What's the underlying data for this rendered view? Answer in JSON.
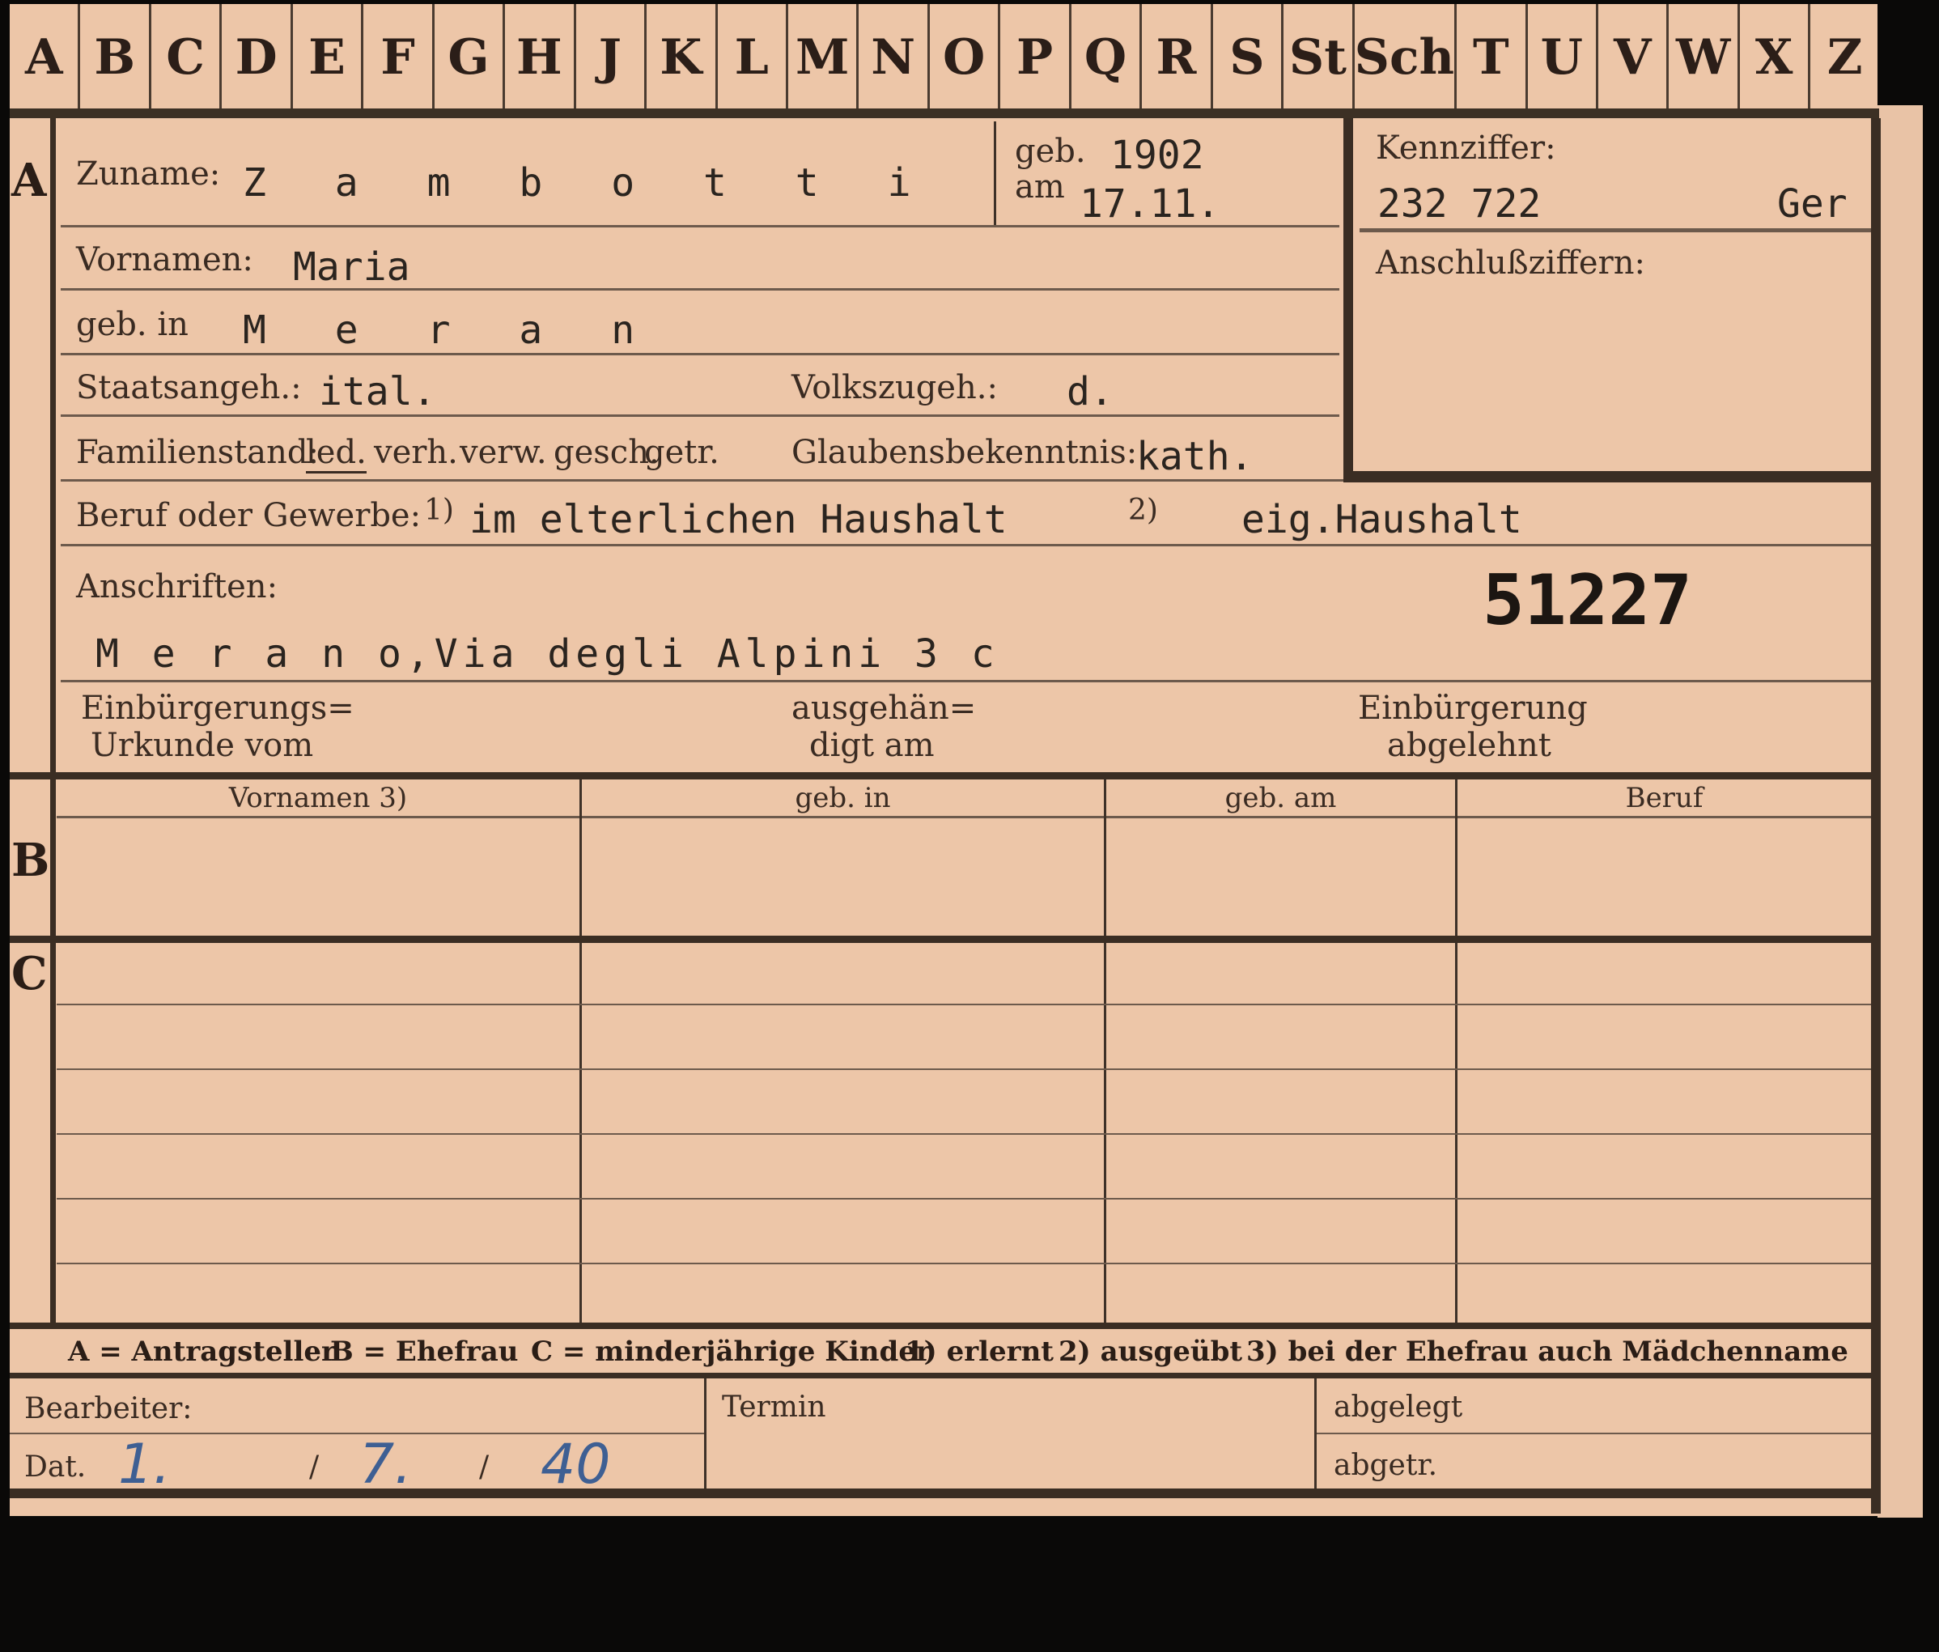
{
  "tabs": [
    "A",
    "B",
    "C",
    "D",
    "E",
    "F",
    "G",
    "H",
    "J",
    "K",
    "L",
    "M",
    "N",
    "O",
    "P",
    "Q",
    "R",
    "S",
    "St",
    "Sch",
    "T",
    "U",
    "V",
    "W",
    "X",
    "Z"
  ],
  "section_a": {
    "letter": "A",
    "zuname_label": "Zuname:",
    "zuname_value": "Z a m b o t t i",
    "geb_label": "geb.",
    "am_label": "am",
    "geb_year": "1902",
    "geb_date": "17.11.",
    "kennziffer_label": "Kennziffer:",
    "kennziffer_value": "232 722",
    "kennziffer_suffix": "Ger",
    "anschluss_label": "Anschlußziffern:",
    "vornamen_label": "Vornamen:",
    "vornamen_value": "Maria",
    "gebin_label": "geb. in",
    "gebin_value": "M e r a n",
    "staats_label": "Staatsangeh.:",
    "staats_value": "ital.",
    "volks_label": "Volkszugeh.:",
    "volks_value": "d.",
    "familienstand_label": "Familienstand:",
    "familienstand_options": [
      "led.",
      "verh.",
      "verw.",
      "gesch.",
      "getr."
    ],
    "familienstand_selected": "led.",
    "glauben_label": "Glaubensbekenntnis:",
    "glauben_value": "kath.",
    "beruf_label": "Beruf oder Gewerbe:",
    "beruf_note1": "1)",
    "beruf_value1": "im elterlichen Haushalt",
    "beruf_note2": "2)",
    "beruf_value2": "eig.Haushalt",
    "anschriften_label": "Anschriften:",
    "anschriften_number": "51227",
    "anschriften_value": "M e r a n o,Via degli Alpini 3 c",
    "einb_urkunde_1": "Einbürgerungs=",
    "einb_urkunde_2": "Urkunde vom",
    "ausgehaendigt_1": "ausgehän=",
    "ausgehaendigt_2": "digt am",
    "einb_abgelehnt_1": "Einbürgerung",
    "einb_abgelehnt_2": "abgelehnt"
  },
  "section_b": {
    "letter": "B",
    "columns": [
      "Vornamen 3)",
      "geb. in",
      "geb. am",
      "Beruf"
    ]
  },
  "section_c": {
    "letter": "C"
  },
  "legend": {
    "a": "A = Antragsteller",
    "b": "B = Ehefrau",
    "c": "C = minderjährige Kinder",
    "n1": "1) erlernt",
    "n2": "2) ausgeübt",
    "n3": "3) bei der Ehefrau auch Mädchenname"
  },
  "footer": {
    "bearbeiter_label": "Bearbeiter:",
    "dat_label": "Dat.",
    "dat_day": "1.",
    "dat_month": "7.",
    "dat_year": "40",
    "sep": "/",
    "termin_label": "Termin",
    "abgelegt_label": "abgelegt",
    "abgetr_label": "abgetr."
  }
}
